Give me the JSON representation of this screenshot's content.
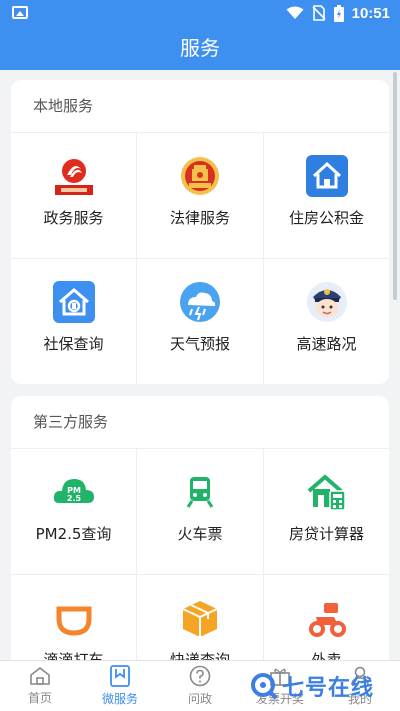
{
  "status_bar": {
    "time": "10:51"
  },
  "header": {
    "title": "服务"
  },
  "local_section": {
    "title": "本地服务",
    "items": [
      {
        "label": "政务服务",
        "icon": "government-icon"
      },
      {
        "label": "法律服务",
        "icon": "court-emblem-icon"
      },
      {
        "label": "住房公积金",
        "icon": "housing-fund-icon"
      },
      {
        "label": "社保查询",
        "icon": "social-security-icon"
      },
      {
        "label": "天气预报",
        "icon": "weather-icon"
      },
      {
        "label": "高速路况",
        "icon": "traffic-police-icon"
      }
    ]
  },
  "third_party_section": {
    "title": "第三方服务",
    "items": [
      {
        "label": "PM2.5查询",
        "icon": "pm25-cloud-icon"
      },
      {
        "label": "火车票",
        "icon": "train-icon"
      },
      {
        "label": "房贷计算器",
        "icon": "mortgage-calculator-icon"
      },
      {
        "label": "滴滴打车",
        "icon": "didi-icon"
      },
      {
        "label": "快递查询",
        "icon": "package-icon"
      },
      {
        "label": "外卖",
        "icon": "scooter-icon"
      }
    ]
  },
  "bottom_nav": {
    "items": [
      {
        "label": "首页",
        "icon": "home-icon"
      },
      {
        "label": "微服务",
        "icon": "bookmark-icon"
      },
      {
        "label": "问政",
        "icon": "question-icon"
      },
      {
        "label": "发票开奖",
        "icon": "gift-icon"
      },
      {
        "label": "我的",
        "icon": "user-icon"
      }
    ],
    "active_index": 1
  },
  "watermark": {
    "text": "七号在线"
  },
  "colors": {
    "primary": "#3d8ff0",
    "green": "#22b36b",
    "orange": "#f5a523"
  }
}
